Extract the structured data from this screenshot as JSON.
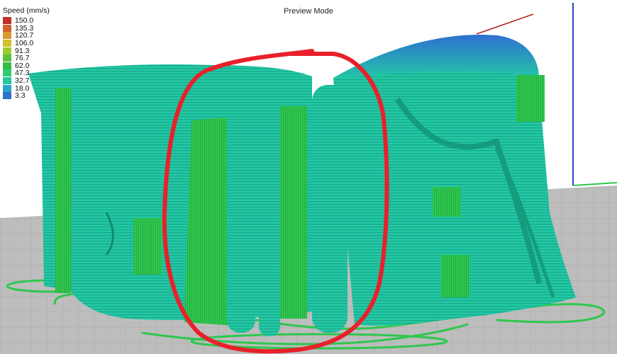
{
  "header": {
    "mode": "Preview Mode"
  },
  "legend": {
    "title": "Speed (mm/s)",
    "items": [
      {
        "label": "150.0",
        "color": "#c0302b"
      },
      {
        "label": "135.3",
        "color": "#d2632b"
      },
      {
        "label": "120.7",
        "color": "#d99a2c"
      },
      {
        "label": "106.0",
        "color": "#d4c12e"
      },
      {
        "label": "91.3",
        "color": "#9ccc2e"
      },
      {
        "label": "76.7",
        "color": "#5ec23a"
      },
      {
        "label": "62.0",
        "color": "#33bb44"
      },
      {
        "label": "47.3",
        "color": "#2ecc71"
      },
      {
        "label": "32.7",
        "color": "#25c6a0"
      },
      {
        "label": "18.0",
        "color": "#2aa6cc"
      },
      {
        "label": "3.3",
        "color": "#2f70c8"
      }
    ]
  },
  "colors": {
    "bed": "#b9b9b9",
    "model": "#22c9a6",
    "support": "#2ec74e",
    "top": "#2f7fd0",
    "annotation": "#e8202a"
  }
}
